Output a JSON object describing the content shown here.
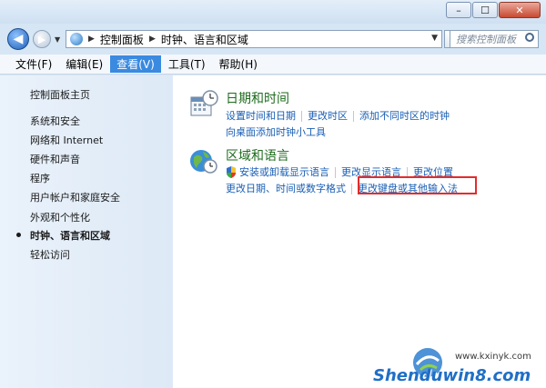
{
  "window": {
    "buttons": {
      "minimize": "–",
      "maximize": "☐",
      "close": "✕"
    }
  },
  "address_bar": {
    "crumbs": [
      "控制面板",
      "时钟、语言和区域"
    ],
    "search_placeholder": "搜索控制面板"
  },
  "menu": [
    "文件(F)",
    "编辑(E)",
    "查看(V)",
    "工具(T)",
    "帮助(H)"
  ],
  "menu_active_index": 2,
  "sidebar": {
    "items": [
      "控制面板主页",
      "系统和安全",
      "网络和 Internet",
      "硬件和声音",
      "程序",
      "用户帐户和家庭安全",
      "外观和个性化",
      "时钟、语言和区域",
      "轻松访问"
    ],
    "current_index": 7
  },
  "categories": [
    {
      "title": "日期和时间",
      "icon": "calendar-clock-icon",
      "links_row1": [
        "设置时间和日期",
        "更改时区",
        "添加不同时区的时钟"
      ],
      "links_row2": [
        "向桌面添加时钟小工具"
      ]
    },
    {
      "title": "区域和语言",
      "icon": "globe-clock-icon",
      "links_row1": [
        "安装或卸载显示语言",
        "更改显示语言",
        "更改位置"
      ],
      "links_row2": [
        "更改日期、时间或数字格式",
        "更改键盘或其他输入法"
      ]
    }
  ],
  "highlight_color": "#e32c2c",
  "watermark": {
    "text": "Shenduwin8.com",
    "domain": "www.kxinyk.com"
  }
}
